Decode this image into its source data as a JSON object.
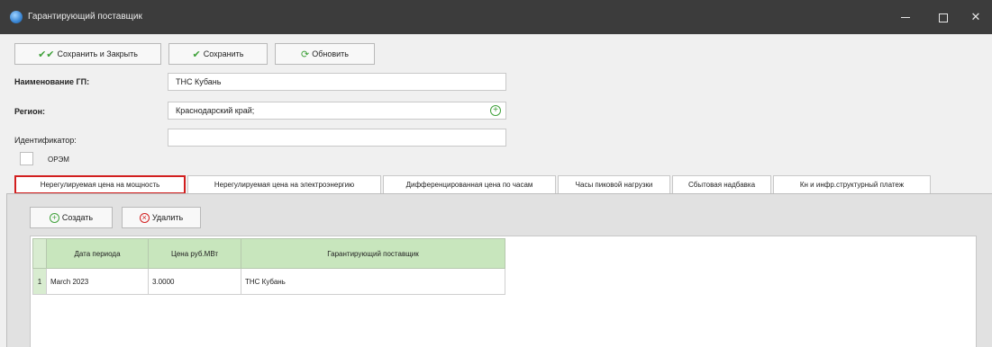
{
  "window": {
    "title": "Гарантирующий поставщик",
    "controls": {
      "minimize": "minimize-icon",
      "maximize": "maximize-icon",
      "close": "close-icon"
    }
  },
  "toolbar": {
    "save_close_label": "Сохранить и Закрыть",
    "save_label": "Сохранить",
    "refresh_label": "Обновить"
  },
  "form": {
    "name_label": "Наименование ГП:",
    "name_value": "ТНС Кубань",
    "region_label": "Регион:",
    "region_value": "Краснодарский край;",
    "id_label": "Идентификатор:",
    "id_value": "",
    "ofzm_label": "ОРЭМ"
  },
  "tabs": [
    {
      "label": "Нерегулируемая цена на мощность",
      "active": true
    },
    {
      "label": "Нерегулируемая цена на электроэнергию",
      "active": false
    },
    {
      "label": "Дифференцированная цена по часам",
      "active": false
    },
    {
      "label": "Часы пиковой нагрузки",
      "active": false
    },
    {
      "label": "Сбытовая надбавка",
      "active": false
    },
    {
      "label": "Кн и инфр.структурный платеж",
      "active": false
    }
  ],
  "panel_toolbar": {
    "create_label": "Создать",
    "delete_label": "Удалить"
  },
  "table": {
    "columns": [
      "Дата периода",
      "Цена руб.МВт",
      "Гарантирующий поставщик"
    ],
    "rows": [
      {
        "num": "1",
        "cells": [
          "March 2023",
          "3.0000",
          "ТНС Кубань"
        ]
      }
    ]
  },
  "colors": {
    "accent_green": "#3fa13a",
    "highlight_red": "#d21f1f",
    "header_green": "#c8e6bd",
    "titlebar": "#3c3c3c"
  }
}
